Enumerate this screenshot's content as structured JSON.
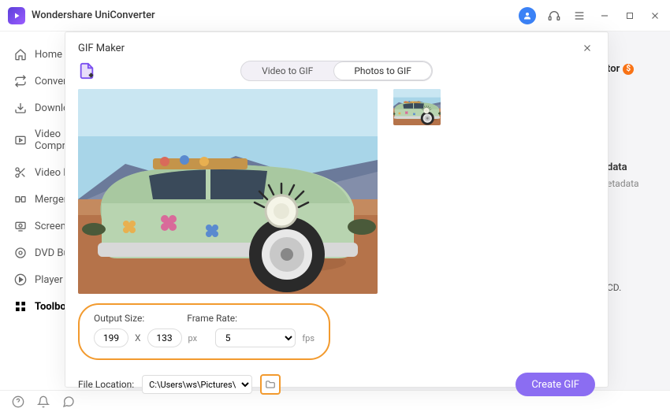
{
  "app": {
    "title": "Wondershare UniConverter"
  },
  "sidebar": {
    "items": [
      {
        "label": "Home"
      },
      {
        "label": "Converter"
      },
      {
        "label": "Downloader"
      },
      {
        "label": "Video Compressor"
      },
      {
        "label": "Video Editor"
      },
      {
        "label": "Merger"
      },
      {
        "label": "Screen Recorder"
      },
      {
        "label": "DVD Burner"
      },
      {
        "label": "Player"
      },
      {
        "label": "Toolbox"
      }
    ],
    "active_index": 9
  },
  "bg_page": {
    "line1": "tor",
    "badge": "$",
    "line2": "data",
    "line3": "etadata",
    "line4": "CD."
  },
  "modal": {
    "title": "GIF Maker",
    "tabs": {
      "video": "Video to GIF",
      "photos": "Photos to GIF",
      "active": "photos"
    },
    "output": {
      "size_label": "Output Size:",
      "frame_label": "Frame Rate:",
      "width": "199",
      "height": "133",
      "x": "X",
      "px": "px",
      "fps_value": "5",
      "fps_unit": "fps"
    },
    "file": {
      "label": "File Location:",
      "path": "C:\\Users\\ws\\Pictures\\Wonders"
    },
    "create_label": "Create GIF"
  }
}
